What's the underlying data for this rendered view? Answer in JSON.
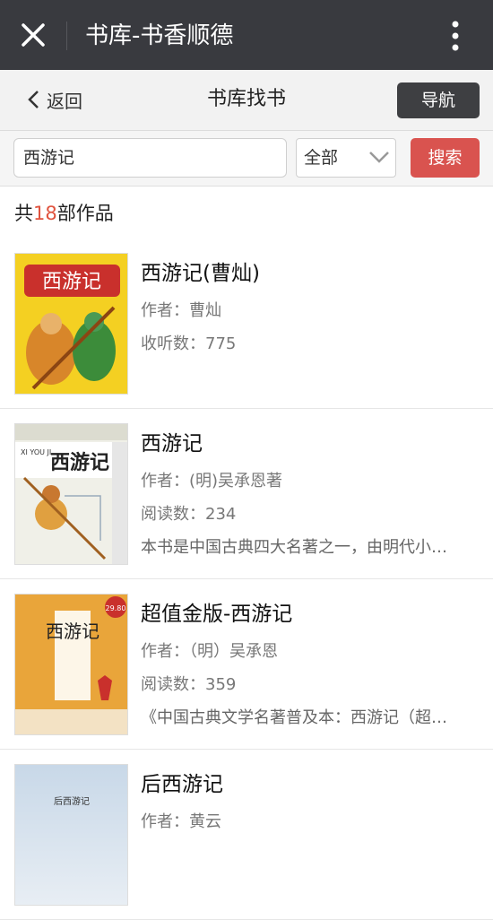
{
  "topbar": {
    "title": "书库-书香顺德"
  },
  "nav": {
    "back_label": "返回",
    "title": "书库找书",
    "nav_button": "导航"
  },
  "search": {
    "value": "西游记",
    "category": "全部",
    "button": "搜索"
  },
  "result": {
    "prefix": "共",
    "count": "18",
    "suffix": "部作品"
  },
  "books": [
    {
      "title": "西游记(曹灿)",
      "author": "作者：曹灿",
      "stat": "收听数：775",
      "desc": ""
    },
    {
      "title": "西游记",
      "author": "作者：(明)吴承恩著",
      "stat": "阅读数：234",
      "desc": "本书是中国古典四大名著之一，由明代小…"
    },
    {
      "title": "超值金版-西游记",
      "author": "作者：（明）吴承恩",
      "stat": "阅读数：359",
      "desc": "《中国古典文学名著普及本：西游记（超…"
    },
    {
      "title": "后西游记",
      "author": "作者：黄云",
      "stat": "",
      "desc": ""
    }
  ],
  "covers": {
    "c1": {
      "text": "西游记"
    },
    "c2": {
      "text": "西游记",
      "pinyin": "XI YOU JI"
    },
    "c3": {
      "text": "西游记",
      "price": "29.80"
    },
    "c4": {
      "text": "后西游记"
    }
  }
}
